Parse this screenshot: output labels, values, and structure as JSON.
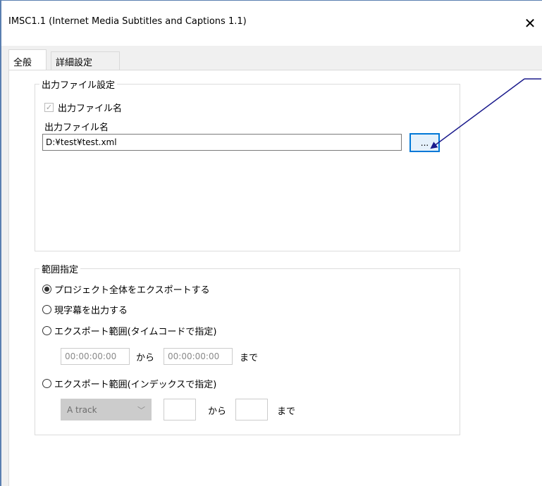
{
  "window": {
    "title": "IMSC1.1 (Internet Media Subtitles and Captions 1.1)",
    "close_glyph": "✕"
  },
  "tabs": [
    {
      "label": "全般",
      "active": true
    },
    {
      "label": "詳細設定",
      "active": false
    }
  ],
  "output_group": {
    "legend": "出力ファイル設定",
    "checkbox_label": "出力ファイル名",
    "checkbox_checked": true,
    "field_label": "出力ファイル名",
    "path_value": "D:¥test¥test.xml",
    "browse_label": "..."
  },
  "range_group": {
    "legend": "範囲指定",
    "options": [
      {
        "label": "プロジェクト全体をエクスポートする",
        "selected": true
      },
      {
        "label": "現字幕を出力する",
        "selected": false
      },
      {
        "label": "エクスポート範囲(タイムコードで指定)",
        "selected": false
      },
      {
        "label": "エクスポート範囲(インデックスで指定)",
        "selected": false
      }
    ],
    "timecode_from": "00:00:00:00",
    "timecode_to": "00:00:00:00",
    "from_text": "から",
    "to_text": "まで",
    "track_value": "A track",
    "index_from": "",
    "index_to": ""
  },
  "colors": {
    "arrow": "#1a1a8c",
    "accent": "#0078d7"
  }
}
